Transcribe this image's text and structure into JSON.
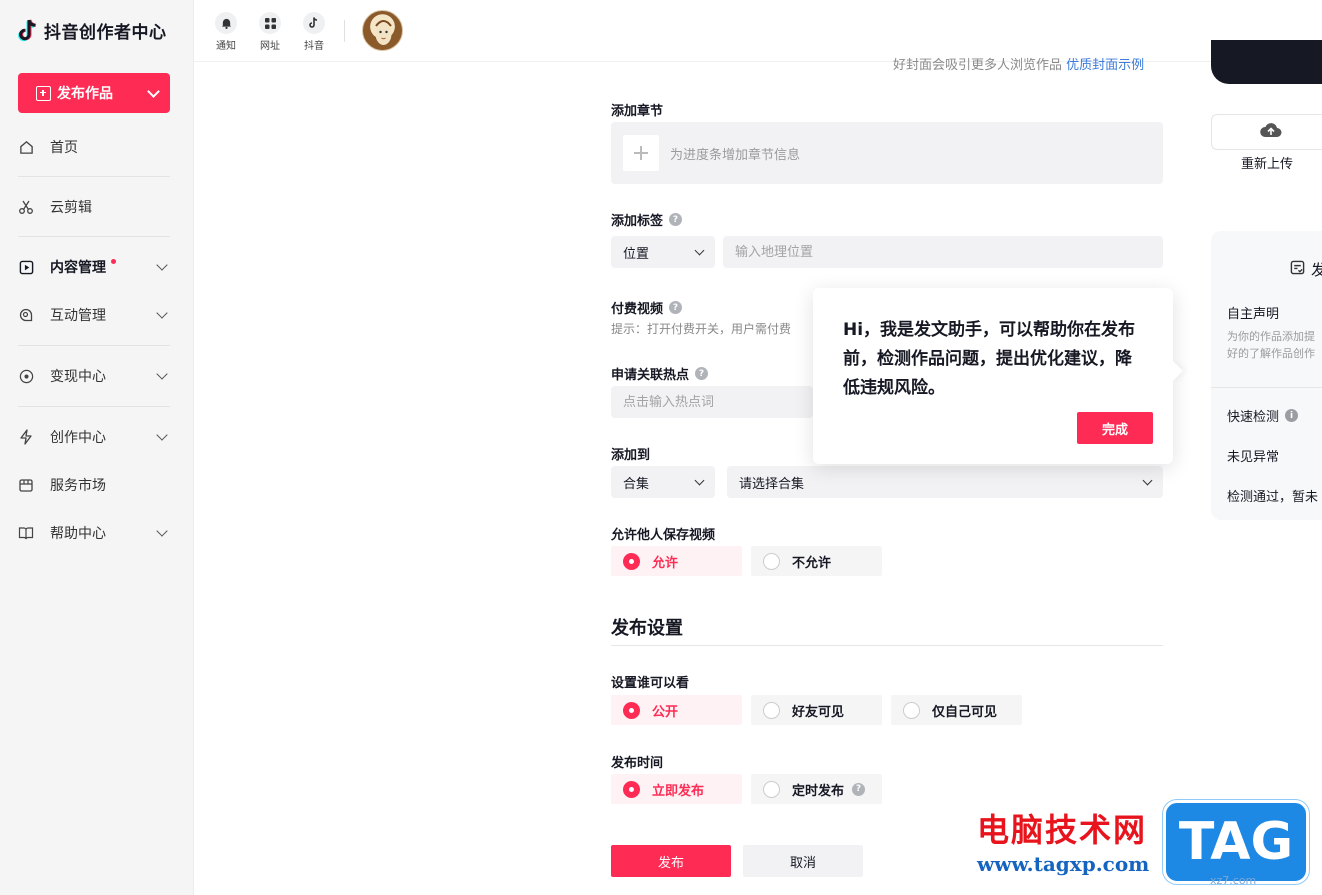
{
  "app": {
    "logo_text": "抖音创作者中心",
    "publish_button": "发布作品",
    "accent_color": "#fe2c55"
  },
  "sidebar": {
    "items": [
      {
        "label": "首页",
        "icon": "home-icon",
        "expandable": false
      },
      {
        "label": "云剪辑",
        "icon": "scissors-icon",
        "expandable": false
      },
      {
        "label": "内容管理",
        "icon": "play-square-icon",
        "expandable": true,
        "active": true,
        "badge_dot": true
      },
      {
        "label": "互动管理",
        "icon": "chat-search-icon",
        "expandable": true
      },
      {
        "label": "变现中心",
        "icon": "target-circle-icon",
        "expandable": true
      },
      {
        "label": "创作中心",
        "icon": "lightning-icon",
        "expandable": true
      },
      {
        "label": "服务市场",
        "icon": "store-icon",
        "expandable": false
      },
      {
        "label": "帮助中心",
        "icon": "book-icon",
        "expandable": true
      }
    ]
  },
  "topbar": {
    "icons": [
      {
        "label": "通知",
        "icon": "bell-icon"
      },
      {
        "label": "网址",
        "icon": "grid-icon"
      },
      {
        "label": "抖音",
        "icon": "douyin-icon"
      }
    ]
  },
  "form": {
    "cover_hint": "好封面会吸引更多人浏览作品",
    "cover_hint_link": "优质封面示例",
    "chapter": {
      "label": "添加章节",
      "placeholder": "为进度条增加章节信息"
    },
    "tags": {
      "label": "添加标签",
      "select_value": "位置",
      "input_placeholder": "输入地理位置"
    },
    "paid": {
      "label": "付费视频",
      "tip": "提示：打开付费开关，用户需付费"
    },
    "hotspot": {
      "label": "申请关联热点",
      "placeholder": "点击输入热点词"
    },
    "add_to": {
      "label": "添加到",
      "select_value": "合集",
      "collection_placeholder": "请选择合集"
    },
    "allow_save": {
      "label": "允许他人保存视频",
      "options": [
        "允许",
        "不允许"
      ],
      "selected": 0
    },
    "publish_settings": {
      "title": "发布设置",
      "visibility": {
        "label": "设置谁可以看",
        "options": [
          "公开",
          "好友可见",
          "仅自己可见"
        ],
        "selected": 0
      },
      "publish_time": {
        "label": "发布时间",
        "options": [
          "立即发布",
          "定时发布"
        ],
        "selected": 0
      }
    },
    "buttons": {
      "publish": "发布",
      "cancel": "取消"
    }
  },
  "right_panel": {
    "reupload": "重新上传",
    "check_title": "发",
    "self_declare": "自主声明",
    "self_declare_desc1": "为你的作品添加提",
    "self_declare_desc2": "好的了解作品创作",
    "quick_check": "快速检测",
    "no_anomaly": "未见异常",
    "check_pass": "检测通过，暂未"
  },
  "popover": {
    "text": "Hi，我是发文助手，可以帮助你在发布前，检测作品问题，提出优化建议，降低违规风险。",
    "done": "完成"
  },
  "watermark": {
    "cn": "电脑技术网",
    "url": "www.tagxp.com",
    "tag": "TAG",
    "small": "xz7.com"
  }
}
